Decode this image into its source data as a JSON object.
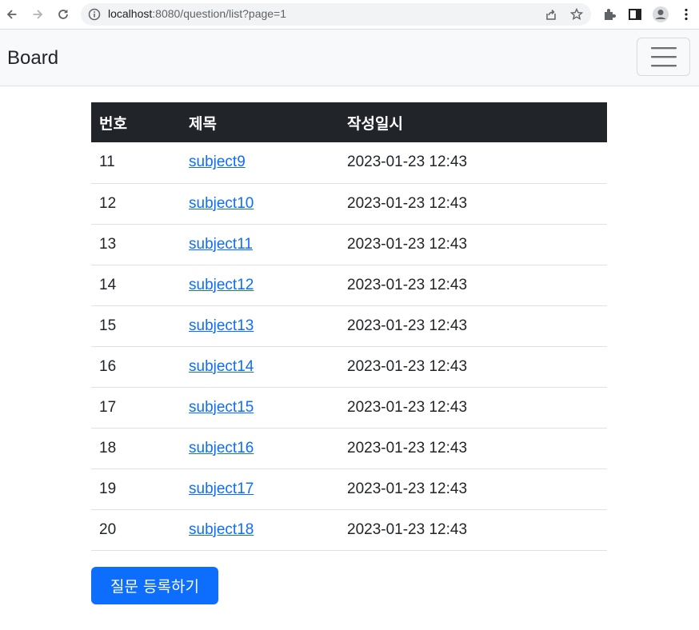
{
  "browser": {
    "url_host": "localhost",
    "url_rest": ":8080/question/list?page=1"
  },
  "navbar": {
    "brand": "Board"
  },
  "table": {
    "headers": [
      "번호",
      "제목",
      "작성일시"
    ],
    "rows": [
      {
        "num": "11",
        "subject": "subject9",
        "date": "2023-01-23 12:43"
      },
      {
        "num": "12",
        "subject": "subject10",
        "date": "2023-01-23 12:43"
      },
      {
        "num": "13",
        "subject": "subject11",
        "date": "2023-01-23 12:43"
      },
      {
        "num": "14",
        "subject": "subject12",
        "date": "2023-01-23 12:43"
      },
      {
        "num": "15",
        "subject": "subject13",
        "date": "2023-01-23 12:43"
      },
      {
        "num": "16",
        "subject": "subject14",
        "date": "2023-01-23 12:43"
      },
      {
        "num": "17",
        "subject": "subject15",
        "date": "2023-01-23 12:43"
      },
      {
        "num": "18",
        "subject": "subject16",
        "date": "2023-01-23 12:43"
      },
      {
        "num": "19",
        "subject": "subject17",
        "date": "2023-01-23 12:43"
      },
      {
        "num": "20",
        "subject": "subject18",
        "date": "2023-01-23 12:43"
      }
    ]
  },
  "actions": {
    "create_label": "질문 등록하기"
  },
  "colors": {
    "primary": "#0d6efd",
    "table_header_bg": "#212529",
    "navbar_bg": "#f8f9fa"
  }
}
